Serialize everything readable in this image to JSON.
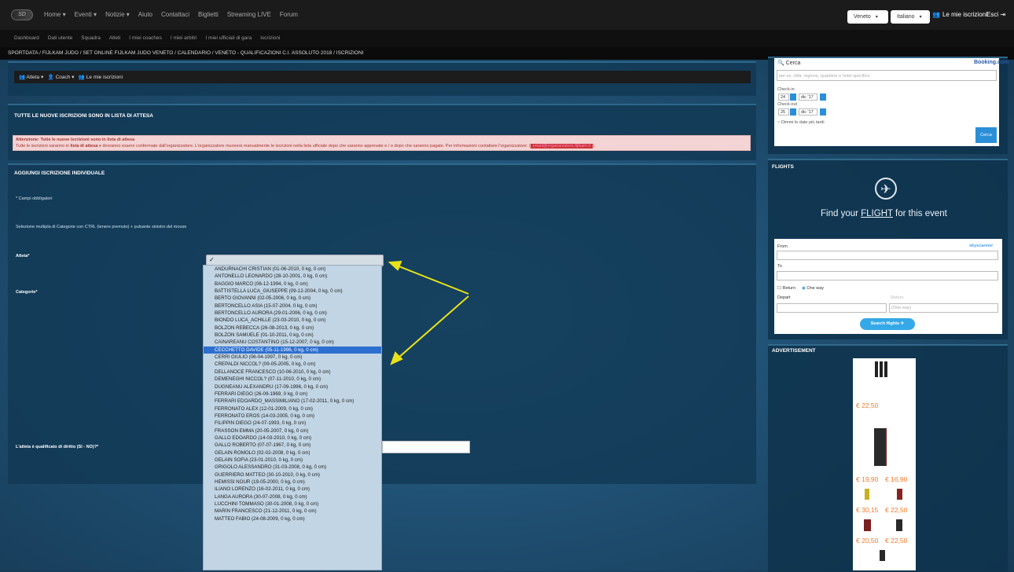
{
  "brand": {
    "logo": "SD"
  },
  "topnav": {
    "items": [
      "Home ▾",
      "Eventi ▾",
      "Notizie ▾",
      "Aiuto",
      "Contattaci",
      "Biglietti",
      "Streaming LIVE",
      "Forum"
    ],
    "region": "Veneto",
    "language": "Italiano",
    "my_entries": "Le mie iscrizioni",
    "logout": "Esci"
  },
  "subnav": {
    "items": [
      "Dashboard",
      "Dati utente",
      "Squadra",
      "Atleti",
      "I miei coaches",
      "I miei arbitri",
      "I miei ufficiali di gara",
      "Iscrizioni"
    ]
  },
  "breadcrumb": "SPORTDATA / FIJLKAM JUDO / SET ONLINE FIJLKAM JUDO VENETO / CALENDARIO / VENETO - QUALIFICAZIONI C.I. ASSOLUTO 2018 / ISCRIZIONI",
  "toolbar": {
    "athletes": "Atleta",
    "coach": "Coach",
    "mine": "Le mie iscrizioni"
  },
  "waitlist": {
    "heading": "TUTTE LE NUOVE ISCRIZIONI SONO IN LISTA DI ATTESA",
    "alert_title": "Attenzione: Tutte le nuove iscrizioni sono in lista di attesa",
    "alert_pre": "Tutte le iscrizioni saranno in ",
    "alert_bold": "lista di attesa",
    "alert_post": " e dovranno essere confermate dall'organizzatore. L'organizzatore muoverà manualmente le iscrizioni nella lista ufficiale dopo che saranno approvate e / o dopo che saranno pagate. Per informazioni contattare l'organizzatore: (",
    "alert_link": "email@organizzatore.fijlkam.it",
    "alert_end": ")"
  },
  "form": {
    "heading": "AGGIUNGI ISCRIZIONE INDIVIDUALE",
    "required_note": "* Campi obbligatori",
    "multi_note": "Selezione multipla di Categorie con CTRL (tenere premuto) + pulsante sinistro del mouse",
    "athlete_label": "Atleta*",
    "category_label": "Categorie*",
    "qualified_label": "L'atleta è qualificato di diritto (SI - NO)?*",
    "selected_mark": "✓"
  },
  "athlete_options": [
    "ANDURNACHI CRISTIAN (01-06-2010, 0 kg, 0 cm)",
    "ANTONELLO LEONARDO (28-10-2001, 0 kg, 0 cm)",
    "BAGGIO MARCO (06-12-1994, 0 kg, 0 cm)",
    "BATTISTELLA LUCA_GIUSEPPE (09-12-2004, 0 kg, 0 cm)",
    "BERTO GIOVANNI (02-05-2006, 0 kg, 0 cm)",
    "BERTONCELLO ASIA (15-07-2004, 0 kg, 0 cm)",
    "BERTONCELLO AURORA (29-01-2006, 0 kg, 0 cm)",
    "BIONDO LUCA_ACHILLE (23-03-2010, 0 kg, 0 cm)",
    "BOLZON REBECCA (26-08-2013, 0 kg, 0 cm)",
    "BOLZON SAMUELE (01-10-2011, 0 kg, 0 cm)",
    "CAINAREANU COSTANTINO (15-12-2007, 0 kg, 0 cm)",
    "CECCHETTO DAVIDE (05-11-1996, 0 kg, 0 cm)",
    "CERRI GIULIO (06-04-1997, 0 kg, 0 cm)",
    "CREPALDI NICCOL? (09-05-2005, 0 kg, 0 cm)",
    "DELLANOCE FRANCESCO (10-06-2010, 0 kg, 0 cm)",
    "DEMENEGHI NICCOL? (07-11-2010, 0 kg, 0 cm)",
    "DUGNEANU ALEXANDRU (17-09-1996, 0 kg, 0 cm)",
    "FERRARI DIEGO (26-09-1969, 0 kg, 0 cm)",
    "FERRARI EDOARDO_MASSIMILIANO (17-02-2011, 0 kg, 0 cm)",
    "FERRONATO ALEX (12-01-2009, 0 kg, 0 cm)",
    "FERRONATO EROS (14-03-2005, 0 kg, 0 cm)",
    "FILIPPIN DIEGO (24-07-1993, 0 kg, 0 cm)",
    "FRASSON EMMA (20-05-2007, 0 kg, 0 cm)",
    "GALLO EDOARDO (14-03-2010, 0 kg, 0 cm)",
    "GALLO ROBERTO (07-07-1967, 0 kg, 0 cm)",
    "GELAIN ROMOLO (02-02-2008, 0 kg, 0 cm)",
    "GELAIN SOFIA (23-01-2010, 0 kg, 0 cm)",
    "GRIGOLO ALESSANDRO (31-03-2008, 0 kg, 0 cm)",
    "GUERRIERO MATTEO (30-10-2010, 0 kg, 0 cm)",
    "HEMISSI NOUR (19-05-2000, 0 kg, 0 cm)",
    "ILIANO LORENZO (16-02-2011, 0 kg, 0 cm)",
    "LANGA AURORA (30-07-2008, 0 kg, 0 cm)",
    "LUCCHINI TOMMASO (30-01-2008, 0 kg, 0 cm)",
    "MARIN FRANCESCO (21-12-2011, 0 kg, 0 cm)",
    "MATTEO FABIO (24-08-2009, 0 kg, 0 cm)"
  ],
  "selected_index": 11,
  "booking": {
    "search": "Cerca",
    "brand": "Booking.com",
    "placeholder": "per es. città, regione, quartiere o hotel specifico",
    "checkin": "Check-in",
    "checkin_day": "24",
    "checkin_month": "dic '17",
    "checkout": "Check-out",
    "checkout_day": "25",
    "checkout_month": "dic '17",
    "no_dates": "Dimmi le date più tardi",
    "button": "Cerca"
  },
  "flights": {
    "heading": "FLIGHTS",
    "tagline_pre": "Find your ",
    "tagline_link": "FLIGHT",
    "tagline_post": " for this event",
    "from": "From",
    "to": "To",
    "return": "Return",
    "oneway": "One way",
    "depart": "Depart",
    "return_label": "Return",
    "oneway_ph": "(One way)",
    "brand": "skyscanner",
    "search": "Search flights"
  },
  "ad": {
    "heading": "ADVERTISEMENT",
    "prices": [
      "€ 22,50",
      "€ 19,90",
      "€ 16,90",
      "€ 30,15",
      "€ 22,50",
      "€ 20,50",
      "€ 22,50"
    ]
  },
  "colors": {
    "alert_bg": "#f3d3d3",
    "alert_text": "#a83232",
    "selected": "#2d6fd0",
    "price": "#f07a2a"
  }
}
